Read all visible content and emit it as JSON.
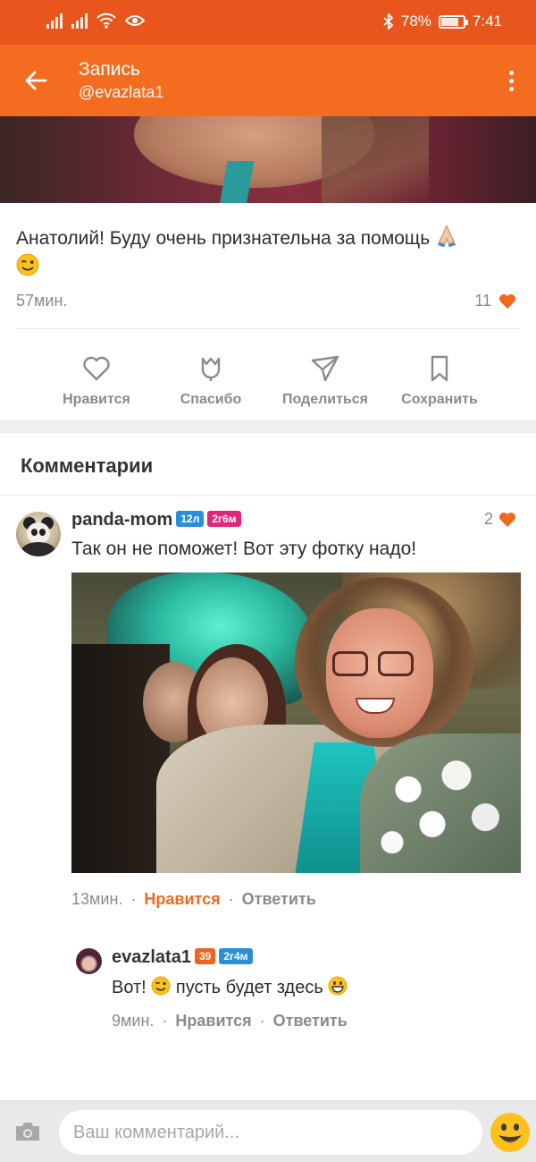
{
  "status_bar": {
    "battery": "78%",
    "battery_level": 0.78,
    "time": "7:41"
  },
  "header": {
    "title": "Запись",
    "subtitle": "@evazlata1",
    "back_icon": "arrow-left-icon",
    "menu_icon": "more-vertical-icon"
  },
  "post": {
    "text": "Анатолий! Буду очень признательна за помощь",
    "time": "57мин.",
    "likes": "11"
  },
  "actions": [
    {
      "label": "Нравится",
      "icon": "heart-outline-icon"
    },
    {
      "label": "Спасибо",
      "icon": "tulip-icon"
    },
    {
      "label": "Поделиться",
      "icon": "send-icon"
    },
    {
      "label": "Сохранить",
      "icon": "bookmark-icon"
    }
  ],
  "comments_section": {
    "title": "Комментарии"
  },
  "comment": {
    "author": "panda-mom",
    "badge1": "12л",
    "badge2": "2г6м",
    "likes": "2",
    "text": "Так он не поможет! Вот эту фотку надо!",
    "time": "13мин.",
    "like_label": "Нравится",
    "reply_label": "Ответить"
  },
  "reply": {
    "author": "evazlata1",
    "badge1": "39",
    "badge2": "2г4м",
    "text_1": "Вот!",
    "text_2": "пусть будет здесь",
    "time": "9мин.",
    "like_label": "Нравится",
    "reply_label": "Ответить"
  },
  "composer": {
    "placeholder": "Ваш комментарий..."
  },
  "colors": {
    "status_bar": "#e8561d",
    "app_bar": "#f46c20",
    "accent": "#ee6a1e",
    "heart": "#f06a1e",
    "badge_blue": "#2a8fd8",
    "badge_pink": "#e0267a",
    "badge_orange": "#f0641e"
  }
}
